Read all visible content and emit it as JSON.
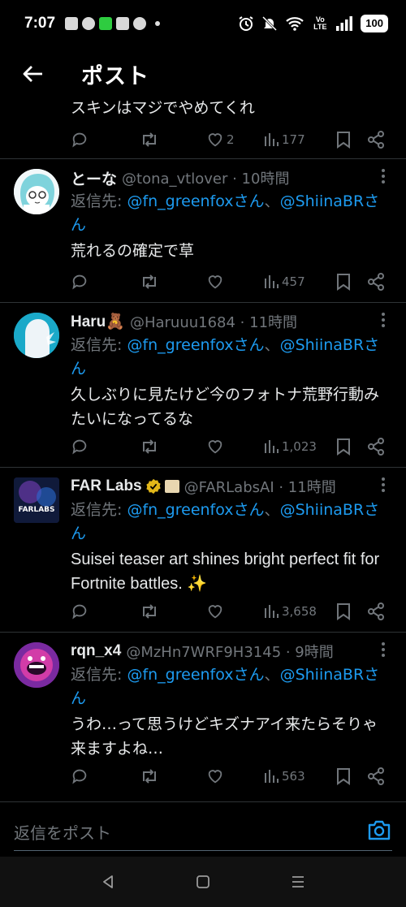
{
  "status_bar": {
    "time": "7:07",
    "battery": "100",
    "network": "Vo LTE"
  },
  "header": {
    "title": "ポスト"
  },
  "prev_post": {
    "text": "スキンはマジでやめてくれ",
    "likes": "2",
    "views": "177"
  },
  "posts": [
    {
      "name": "とーな",
      "handle": "@tona_vtlover · 10時間",
      "reply_prefix": "返信先: ",
      "reply_to_1": "@fn_greenfoxさん",
      "reply_sep": "、",
      "reply_to_2": "@ShiinaBRさん",
      "text": "荒れるの確定で草",
      "views": "457"
    },
    {
      "name": "Haru🧸",
      "handle": "@Haruuu1684 · 11時間",
      "reply_prefix": "返信先: ",
      "reply_to_1": "@fn_greenfoxさん",
      "reply_sep": "、",
      "reply_to_2": "@ShiinaBRさん",
      "text": "久しぶりに見たけど今のフォトナ荒野行動みたいになってるな",
      "views": "1,023"
    },
    {
      "name": "FAR Labs",
      "handle": "@FARLabsAI · 11時間",
      "reply_prefix": "返信先: ",
      "reply_to_1": "@fn_greenfoxさん",
      "reply_sep": "、",
      "reply_to_2": "@ShiinaBRさん",
      "text": "Suisei teaser art shines bright perfect fit for Fortnite battles. ✨",
      "views": "3,658"
    },
    {
      "name": "rqn_x4",
      "handle": "@MzHn7WRF9H3145 · 9時間",
      "reply_prefix": "返信先: ",
      "reply_to_1": "@fn_greenfoxさん",
      "reply_sep": "、",
      "reply_to_2": "@ShiinaBRさん",
      "text": "うわ…って思うけどキズナアイ来たらそりゃ来ますよね…",
      "views": "563"
    }
  ],
  "reply_bar": {
    "placeholder": "返信をポスト"
  },
  "colors": {
    "accent": "#1d9bf0",
    "muted": "#71767b",
    "background": "#000000"
  }
}
